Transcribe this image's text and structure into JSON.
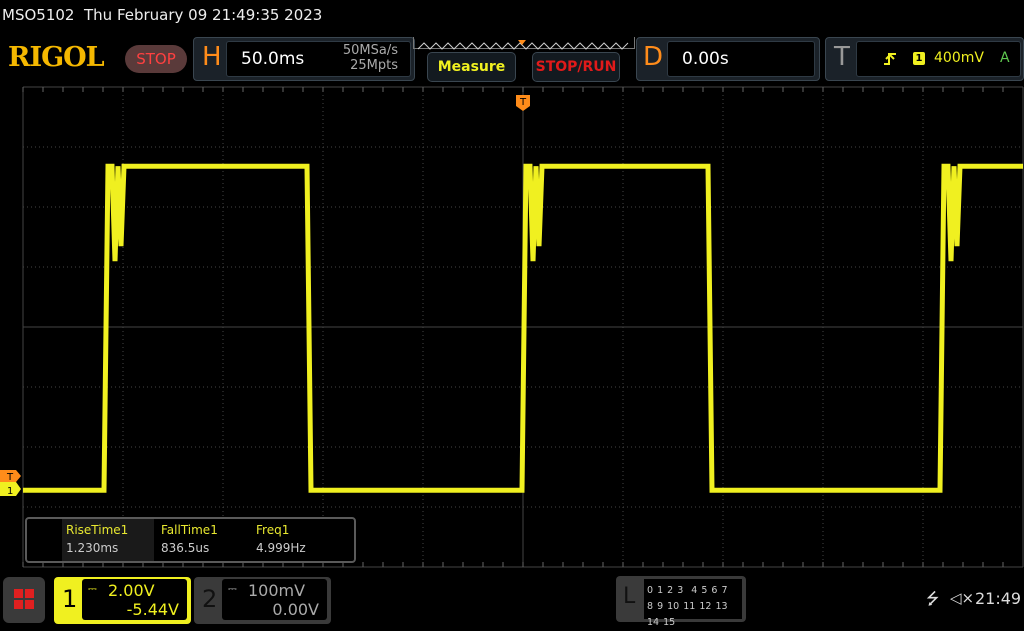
{
  "title_bar": {
    "model": "MSO5102",
    "datetime": "Thu February 09 21:49:35 2023"
  },
  "logo": "RIGOL",
  "run_status": "STOP",
  "horizontal": {
    "letter": "H",
    "timebase": "50.0ms",
    "sample_rate": "50MSa/s",
    "memory_depth": "25Mpts"
  },
  "buttons": {
    "measure": "Measure",
    "stop_run": "STOP/RUN"
  },
  "delay": {
    "letter": "D",
    "value": "0.00s"
  },
  "trigger": {
    "letter": "T",
    "slope_icon": "rising-edge-icon",
    "source": "1",
    "level": "400mV",
    "mode": "A"
  },
  "markers": {
    "trigger": "T",
    "channel1": "1"
  },
  "measurements": [
    {
      "name": "RiseTime1",
      "value": "1.230ms"
    },
    {
      "name": "FallTime1",
      "value": "836.5us"
    },
    {
      "name": "Freq1",
      "value": "4.999Hz"
    }
  ],
  "channel1": {
    "number": "1",
    "scale": "2.00V",
    "offset": "-5.44V",
    "color": "#f0f020"
  },
  "channel2": {
    "number": "2",
    "scale": "100mV",
    "offset": "0.00V"
  },
  "logic": {
    "letter": "L",
    "row1": "0 1 2 3  4 5 6 7",
    "row2": "8 9 10 11 12 13 14 15"
  },
  "status": {
    "usb_icon": "usb-icon",
    "sound_icon": "speaker-muted-icon",
    "time": "21:49"
  },
  "waveform": {
    "time_unit": "ms",
    "high_V": 10.8,
    "low_V": 0,
    "rising_edges_ms": [
      -208.5,
      0.5,
      209.5
    ],
    "falling_edges_ms": [
      -107.5,
      93
    ]
  },
  "colors": {
    "accent": "#ff8c1a",
    "ch1": "#f0f020",
    "stop": "#ff4040"
  }
}
